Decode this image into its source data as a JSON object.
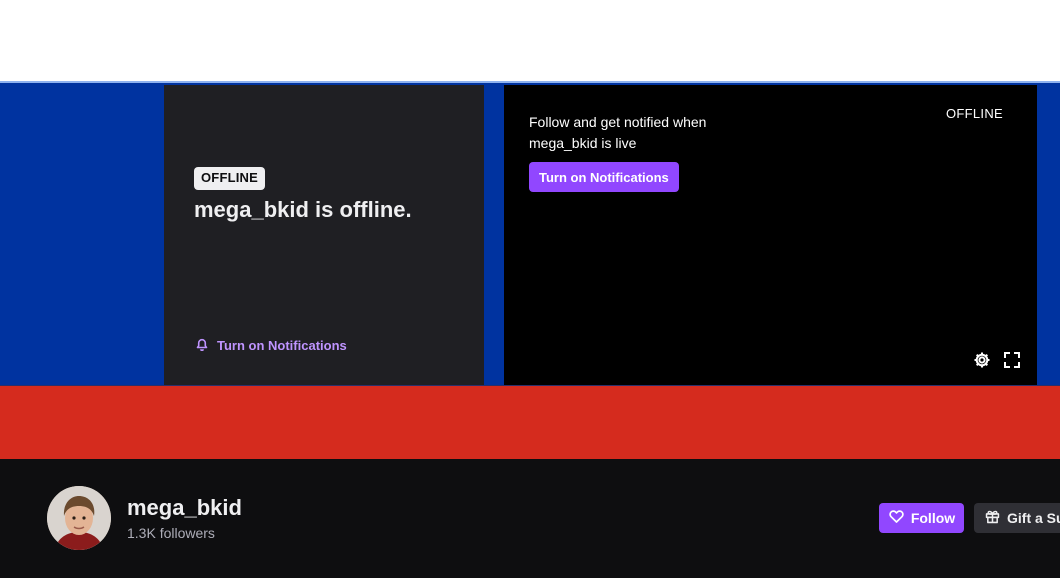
{
  "offline_panel": {
    "badge": "OFFLINE",
    "title": "mega_bkid is offline.",
    "notifications_link": "Turn on Notifications",
    "icon": "bell-icon"
  },
  "player": {
    "follow_text": "Follow and get notified when mega_bkid is live",
    "notifications_button": "Turn on Notifications",
    "status_label": "OFFLINE",
    "controls": [
      "settings-icon",
      "fullscreen-icon"
    ]
  },
  "channel": {
    "name": "mega_bkid",
    "followers": "1.3K followers",
    "follow_button": "Follow",
    "gift_button": "Gift a Sub"
  },
  "colors": {
    "banner_blue": "#0033a0",
    "banner_red": "#d52b1e",
    "accent_purple": "#9147ff",
    "link_purple": "#bf94ff",
    "panel_bg": "#1f1f23",
    "bar_bg": "#0e0e10"
  }
}
